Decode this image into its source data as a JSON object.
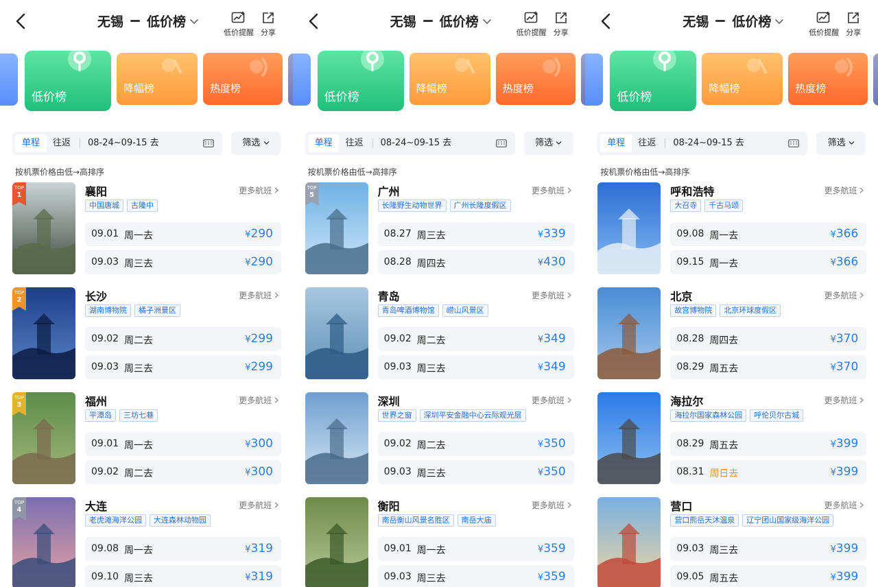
{
  "header": {
    "city": "无锡",
    "rank_title": "低价榜",
    "alert_label": "低价提醒",
    "share_label": "分享"
  },
  "tabs": {
    "low": "低价榜",
    "drop": "降幅榜",
    "hot": "热度榜"
  },
  "filter": {
    "one_way": "单程",
    "round_trip": "往返",
    "date_range": "08-24~09-15 去",
    "screen": "筛选",
    "sort_note": "按机票价格由低→高排序"
  },
  "more_label": "更多航班",
  "currency": "¥",
  "colors": {
    "accent": "#2b7de9",
    "weekend": "#f0932b",
    "rank1": "#e8552f",
    "low_tab": "#20c07a"
  },
  "panels": [
    {
      "cards": [
        {
          "rank": "1",
          "badge_text": "TOP",
          "city": "襄阳",
          "tags": [
            "中国唐城",
            "古隆中"
          ],
          "flights": [
            {
              "date": "09.01",
              "weekday": "周一去",
              "price": "290"
            },
            {
              "date": "09.03",
              "weekday": "周三去",
              "price": "290"
            }
          ]
        },
        {
          "rank": "2",
          "badge_text": "TOP",
          "city": "长沙",
          "tags": [
            "湖南博物院",
            "橘子洲景区"
          ],
          "flights": [
            {
              "date": "09.02",
              "weekday": "周二去",
              "price": "299"
            },
            {
              "date": "09.03",
              "weekday": "周三去",
              "price": "299"
            }
          ]
        },
        {
          "rank": "3",
          "badge_text": "TOP",
          "city": "福州",
          "tags": [
            "平潭岛",
            "三坊七巷"
          ],
          "flights": [
            {
              "date": "09.01",
              "weekday": "周一去",
              "price": "300"
            },
            {
              "date": "09.02",
              "weekday": "周二去",
              "price": "300"
            }
          ]
        },
        {
          "rank": "4",
          "badge_text": "TOP",
          "city": "大连",
          "tags": [
            "老虎滩海洋公园",
            "大连森林动物园"
          ],
          "flights": [
            {
              "date": "09.08",
              "weekday": "周一去",
              "price": "319"
            },
            {
              "date": "09.10",
              "weekday": "周三去",
              "price": "319"
            }
          ]
        }
      ]
    },
    {
      "cards": [
        {
          "rank": "5",
          "badge_text": "TOP",
          "city": "广州",
          "tags": [
            "长隆野生动物世界",
            "广州长隆度假区"
          ],
          "flights": [
            {
              "date": "08.27",
              "weekday": "周三去",
              "price": "339"
            },
            {
              "date": "08.28",
              "weekday": "周四去",
              "price": "430"
            }
          ]
        },
        {
          "rank": "",
          "badge_text": "",
          "city": "青岛",
          "tags": [
            "青岛啤酒博物馆",
            "崂山风景区"
          ],
          "flights": [
            {
              "date": "09.02",
              "weekday": "周二去",
              "price": "349"
            },
            {
              "date": "09.03",
              "weekday": "周三去",
              "price": "349"
            }
          ]
        },
        {
          "rank": "",
          "badge_text": "",
          "city": "深圳",
          "tags": [
            "世界之窗",
            "深圳平安金融中心云际观光层"
          ],
          "flights": [
            {
              "date": "09.02",
              "weekday": "周二去",
              "price": "350"
            },
            {
              "date": "09.03",
              "weekday": "周三去",
              "price": "350"
            }
          ]
        },
        {
          "rank": "",
          "badge_text": "",
          "city": "衡阳",
          "tags": [
            "南岳衡山风景名胜区",
            "南岳大庙"
          ],
          "flights": [
            {
              "date": "09.01",
              "weekday": "周一去",
              "price": "359"
            },
            {
              "date": "09.03",
              "weekday": "周三去",
              "price": "359"
            }
          ]
        }
      ]
    },
    {
      "cards": [
        {
          "rank": "",
          "badge_text": "",
          "city": "呼和浩特",
          "tags": [
            "大召寺",
            "千古马颂"
          ],
          "flights": [
            {
              "date": "09.08",
              "weekday": "周一去",
              "price": "366"
            },
            {
              "date": "09.15",
              "weekday": "周一去",
              "price": "366"
            }
          ]
        },
        {
          "rank": "",
          "badge_text": "",
          "city": "北京",
          "tags": [
            "故宫博物院",
            "北京环球度假区"
          ],
          "flights": [
            {
              "date": "08.28",
              "weekday": "周四去",
              "price": "370"
            },
            {
              "date": "08.29",
              "weekday": "周五去",
              "price": "370"
            }
          ]
        },
        {
          "rank": "",
          "badge_text": "",
          "city": "海拉尔",
          "tags": [
            "海拉尔国家森林公园",
            "呼伦贝尔古城"
          ],
          "flights": [
            {
              "date": "08.29",
              "weekday": "周五去",
              "price": "399"
            },
            {
              "date": "08.31",
              "weekday": "周日去",
              "price": "399",
              "weekend": true
            }
          ]
        },
        {
          "rank": "",
          "badge_text": "",
          "city": "营口",
          "tags": [
            "营口熊岳天沐温泉",
            "辽宁团山国家级海洋公园"
          ],
          "flights": [
            {
              "date": "09.03",
              "weekday": "周三去",
              "price": "399"
            },
            {
              "date": "09.05",
              "weekday": "周五去",
              "price": "399"
            }
          ]
        }
      ]
    }
  ]
}
